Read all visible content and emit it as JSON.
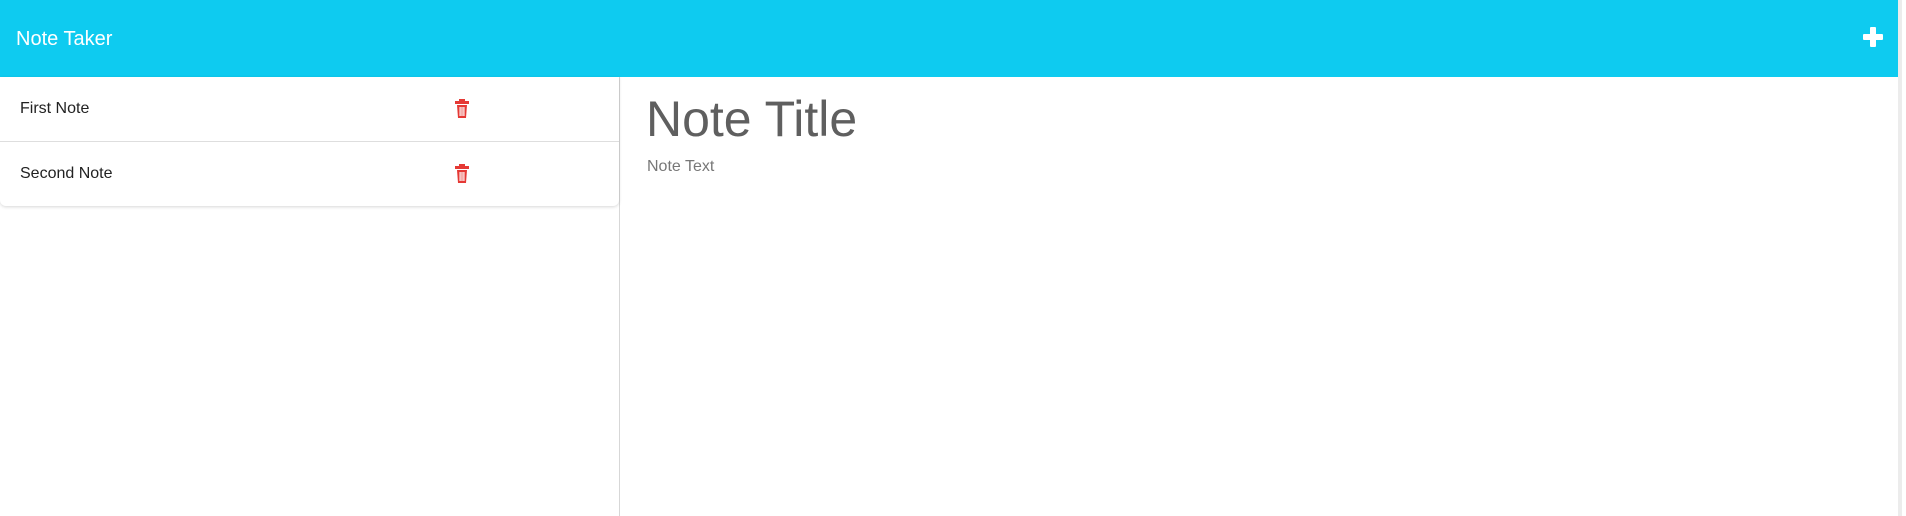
{
  "app": {
    "title": "Note Taker",
    "accent_color": "#0ecbf0"
  },
  "header": {
    "new_note_icon": "plus-icon"
  },
  "notes": {
    "items": [
      {
        "label": "First Note",
        "delete_icon": "trash-icon"
      },
      {
        "label": "Second Note",
        "delete_icon": "trash-icon"
      }
    ],
    "delete_color": "#e53935"
  },
  "editor": {
    "title_placeholder": "Note Title",
    "text_placeholder": "Note Text"
  }
}
